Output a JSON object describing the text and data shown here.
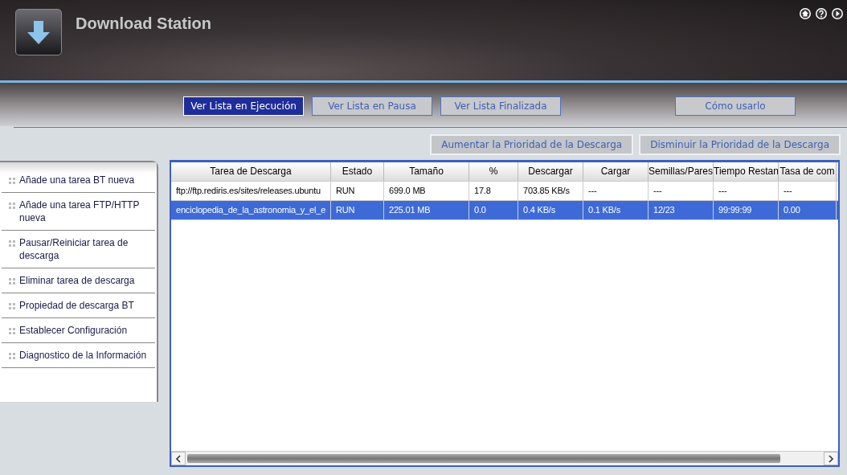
{
  "app": {
    "title": "Download Station"
  },
  "tabs": [
    {
      "label": "Ver Lista en Ejecución",
      "selected": true
    },
    {
      "label": "Ver Lista en Pausa",
      "selected": false
    },
    {
      "label": "Ver Lista Finalizada",
      "selected": false
    },
    {
      "label": "Cómo usarlo",
      "selected": false
    }
  ],
  "actions": [
    "Aumentar la Prioridad de la Descarga",
    "Disminuir la Prioridad de la Descarga"
  ],
  "sidebar": {
    "items": [
      "Añade una tarea BT nueva",
      "Añade una tarea FTP/HTTP nueva",
      "Pausar/Reiniciar tarea de descarga",
      "Eliminar tarea de descarga",
      "Propiedad de descarga BT",
      "Establecer Configuración",
      "Diagnostico de la Información"
    ]
  },
  "table": {
    "columns": [
      "Tarea de Descarga",
      "Estado",
      "Tamaño",
      "%",
      "Descargar",
      "Cargar",
      "Semillas/Pares",
      "Tiempo Restan",
      "Tasa de com"
    ],
    "rows": [
      {
        "cells": [
          "ftp://ftp.rediris.es/sites/releases.ubuntu",
          "RUN",
          "699.0 MB",
          "17.8",
          "703.85 KB/s",
          "---",
          "---",
          "---",
          "---"
        ],
        "selected": false
      },
      {
        "cells": [
          "enciclopedia_de_la_astronomia_y_el_e",
          "RUN",
          "225.01 MB",
          "0.0",
          "0.4 KB/s",
          "0.1 KB/s",
          "12/23",
          "99:99:99",
          "0.00"
        ],
        "selected": true
      }
    ]
  }
}
